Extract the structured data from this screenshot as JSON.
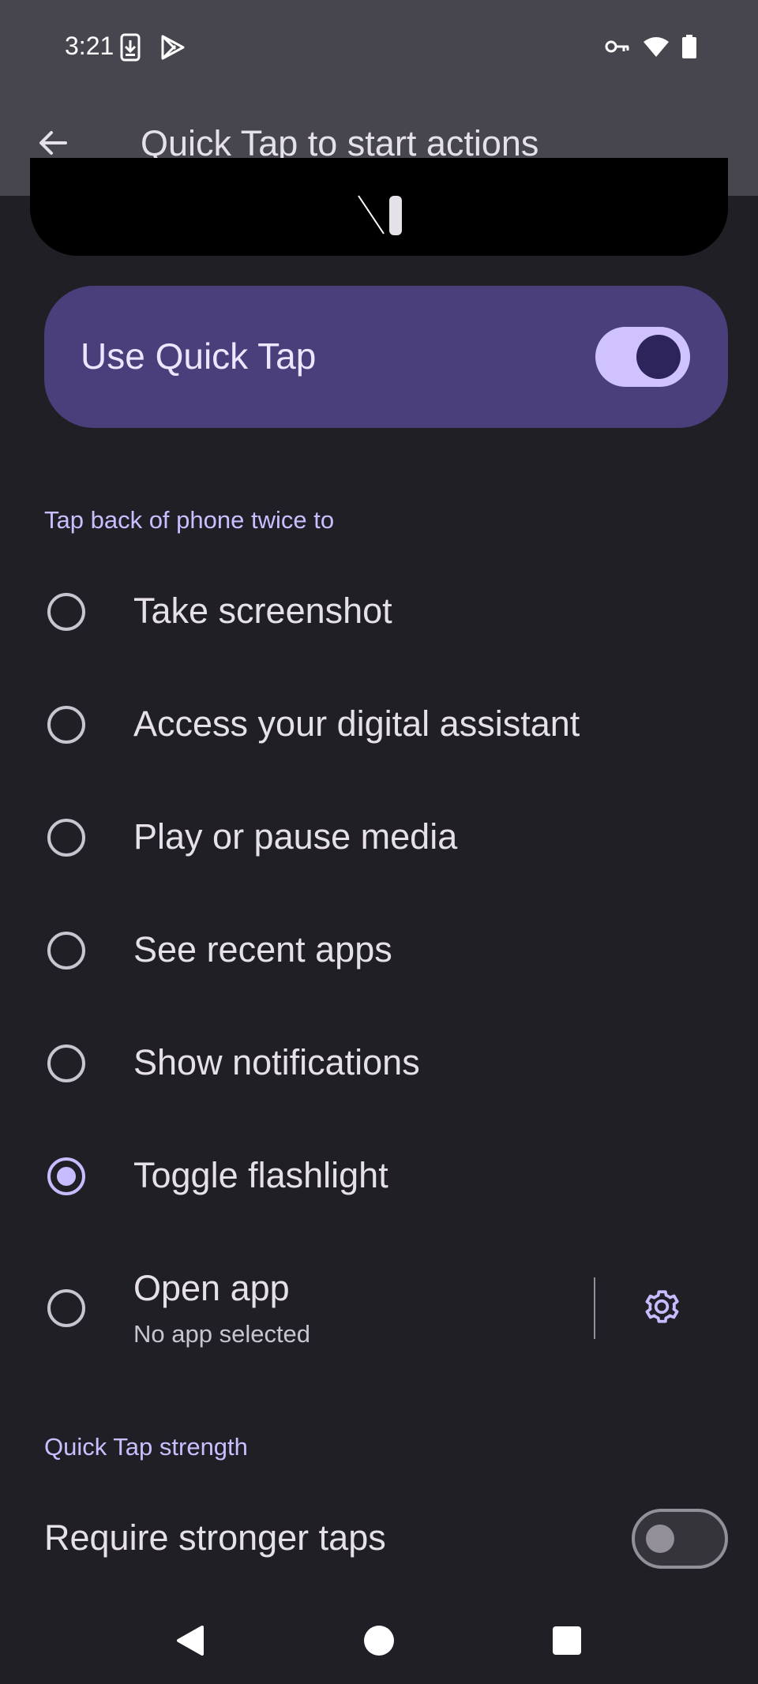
{
  "status_bar": {
    "time": "3:21",
    "left_icons": [
      "download-icon",
      "play-store-icon"
    ],
    "right_icons": [
      "vpn-key-icon",
      "wifi-icon",
      "battery-icon"
    ]
  },
  "app_bar": {
    "title": "Quick Tap to start actions",
    "back_icon": "arrow-back-icon"
  },
  "main_toggle": {
    "label": "Use Quick Tap",
    "enabled": true
  },
  "actions_section": {
    "header": "Tap back of phone twice to",
    "options": [
      {
        "label": "Take screenshot",
        "selected": false
      },
      {
        "label": "Access your digital assistant",
        "selected": false
      },
      {
        "label": "Play or pause media",
        "selected": false
      },
      {
        "label": "See recent apps",
        "selected": false
      },
      {
        "label": "Show notifications",
        "selected": false
      },
      {
        "label": "Toggle flashlight",
        "selected": true
      },
      {
        "label": "Open app",
        "subtitle": "No app selected",
        "selected": false
      }
    ]
  },
  "strength_section": {
    "header": "Quick Tap strength",
    "stronger_taps_label": "Require stronger taps",
    "stronger_taps_enabled": false
  },
  "nav_bar": {
    "buttons": [
      "back-triangle-icon",
      "home-circle-icon",
      "recents-square-icon"
    ]
  },
  "colors": {
    "background": "#201f25",
    "header": "#47464e",
    "card": "#4a3f7a",
    "accent": "#c7bcff"
  }
}
